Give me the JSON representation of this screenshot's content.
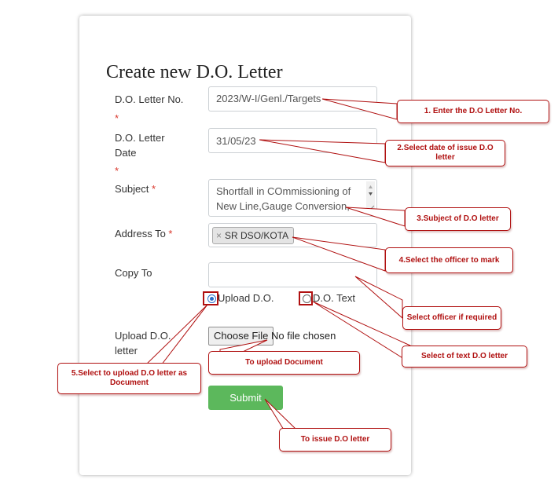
{
  "page": {
    "title": "Create new D.O. Letter"
  },
  "form": {
    "do_letter_no": {
      "label": "D.O. Letter No.",
      "value": "2023/W-I/Genl./Targets"
    },
    "do_letter_date": {
      "label_line1": "D.O. Letter",
      "label_line2": "Date",
      "value": "31/05/23"
    },
    "subject": {
      "label": "Subject",
      "line1": "Shortfall in COmmissioning of",
      "line2": "New Line,Gauge Conversion,"
    },
    "address_to": {
      "label": "Address To",
      "tag": "SR DSO/KOTA",
      "tag_remove": "×"
    },
    "copy_to": {
      "label": "Copy To",
      "value": ""
    },
    "required_mark": "*",
    "mode": {
      "upload_label": "Upload D.O.",
      "text_label": "D.O. Text",
      "selected": "upload"
    },
    "upload": {
      "label_line1": "Upload D.O.",
      "label_line2": "letter",
      "button": "Choose File",
      "status": "No file chosen"
    },
    "submit_label": "Submit"
  },
  "callouts": {
    "c1": "1. Enter the D.O Letter No.",
    "c2": "2.Select date of issue D.O letter",
    "c3": "3.Subject of D.O letter",
    "c4": "4.Select the officer to mark",
    "c5": "Select officer if required",
    "c6": "Select of text D.O letter",
    "c7": "To upload Document",
    "c8": "5.Select to upload D.O letter as Document",
    "c9": "To issue D.O letter"
  },
  "colors": {
    "accent": "#2a6ec9",
    "submit": "#5cb85c",
    "annotation": "#b01010",
    "required": "#d9362b"
  }
}
